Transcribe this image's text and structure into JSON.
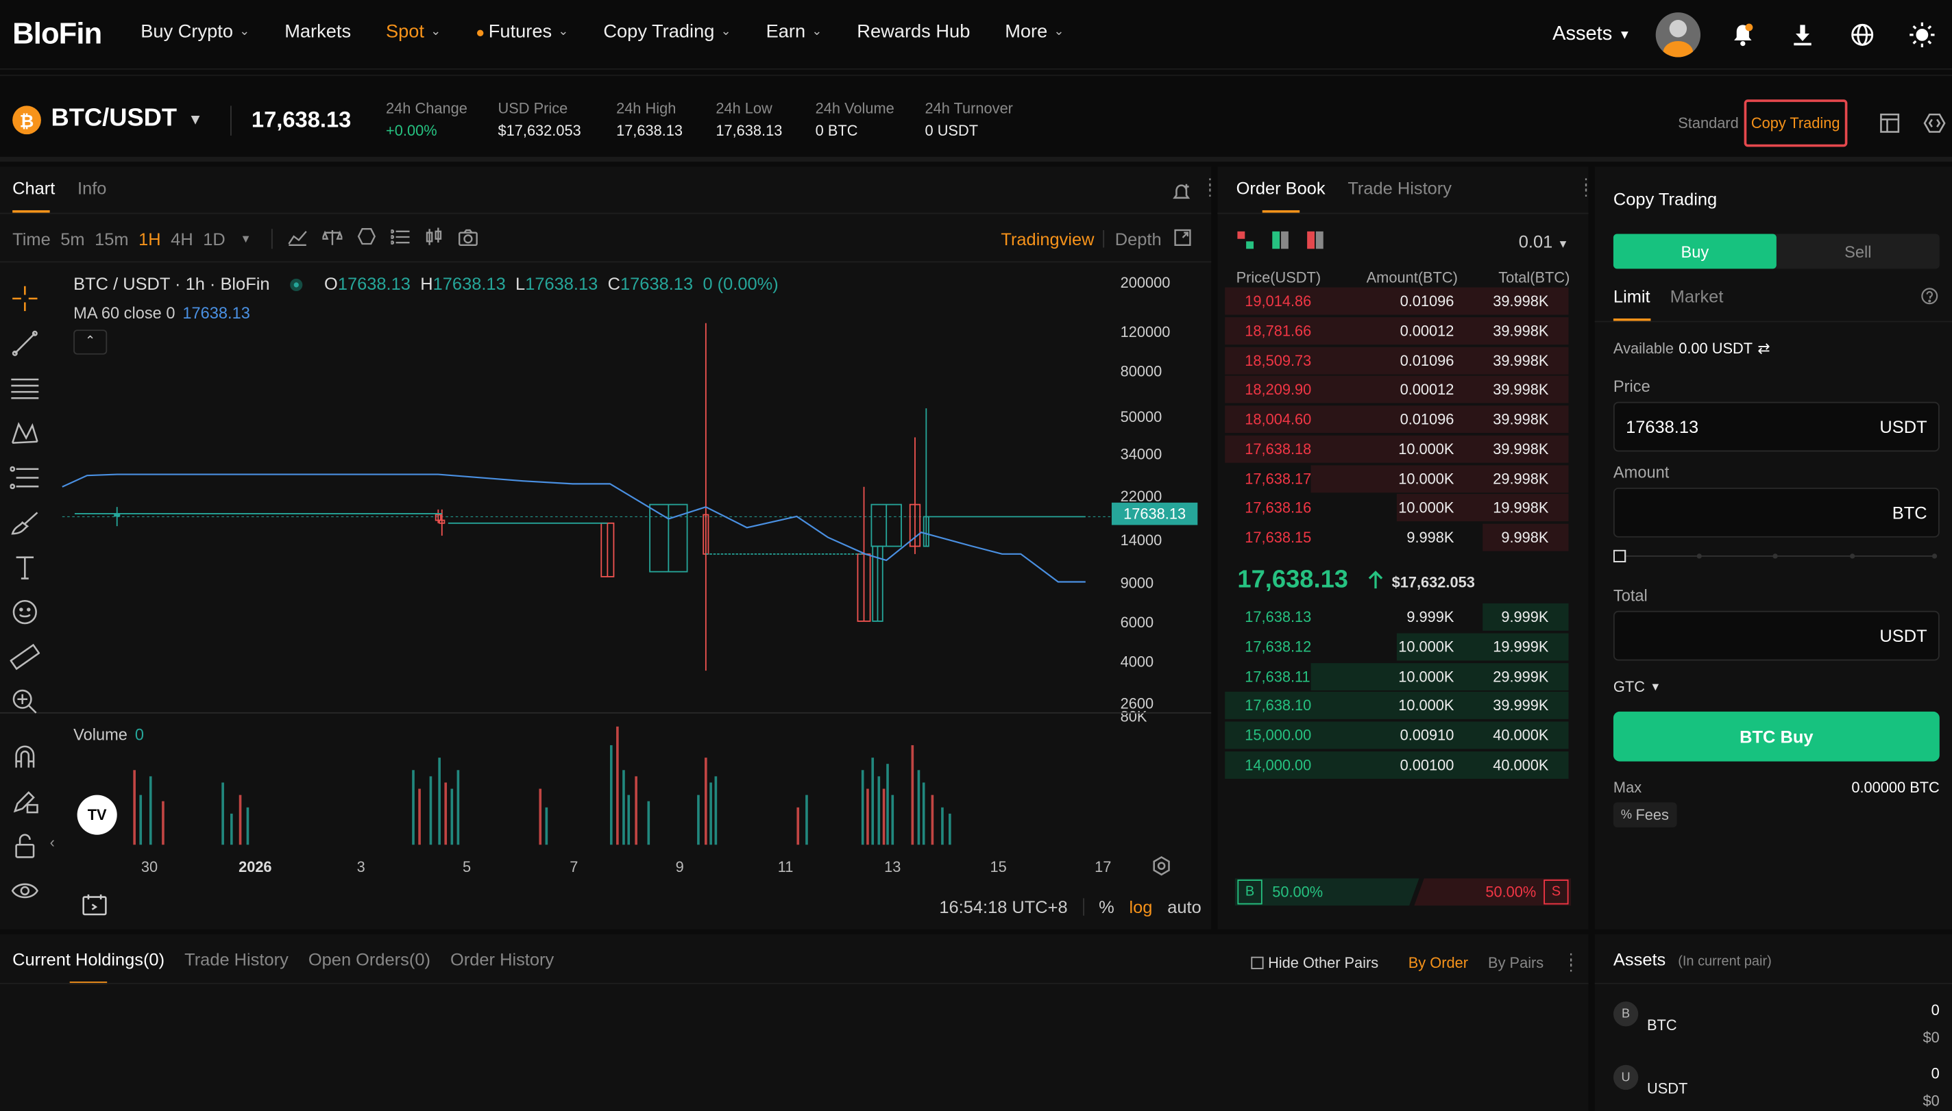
{
  "brand": "BloFin",
  "nav": {
    "items": [
      {
        "label": "Buy Crypto",
        "chev": true
      },
      {
        "label": "Markets",
        "chev": false
      },
      {
        "label": "Spot",
        "chev": true,
        "active": true
      },
      {
        "label": "Futures",
        "chev": true,
        "fire": true
      },
      {
        "label": "Copy Trading",
        "chev": true
      },
      {
        "label": "Earn",
        "chev": true
      },
      {
        "label": "Rewards Hub",
        "chev": false
      },
      {
        "label": "More",
        "chev": true
      }
    ],
    "assets": "Assets"
  },
  "ticker": {
    "pair": "BTC/USDT",
    "last": "17,638.13",
    "stats": [
      {
        "label": "24h Change",
        "value": "+0.00%",
        "green": true
      },
      {
        "label": "USD Price",
        "value": "$17,632.053"
      },
      {
        "label": "24h High",
        "value": "17,638.13"
      },
      {
        "label": "24h Low",
        "value": "17,638.13"
      },
      {
        "label": "24h Volume",
        "value": "0 BTC"
      },
      {
        "label": "24h Turnover",
        "value": "0 USDT"
      }
    ],
    "mode_standard": "Standard",
    "mode_copy": "Copy Trading"
  },
  "chart": {
    "tabs": [
      "Chart",
      "Info"
    ],
    "timeframes": [
      "Time",
      "5m",
      "15m",
      "1H",
      "4H",
      "1D"
    ],
    "active_tf": "1H",
    "tradingview": "Tradingview",
    "depth": "Depth",
    "legend_title": "BTC / USDT · 1h · BloFin",
    "ohlc": {
      "o": "17638.13",
      "h": "17638.13",
      "l": "17638.13",
      "c": "17638.13",
      "chg": "0 (0.00%)"
    },
    "ma_label": "MA 60 close 0",
    "ma_value": "17638.13",
    "price_label": "17638.13",
    "volume_label": "Volume",
    "volume_value": "0",
    "time": "16:54:18 UTC+8",
    "pct": "%",
    "log": "log",
    "auto": "auto"
  },
  "chart_data": {
    "type": "candlestick",
    "y_scale": "log",
    "y_ticks": [
      "200000",
      "120000",
      "80000",
      "50000",
      "34000",
      "22000",
      "14000",
      "9000",
      "6000",
      "4000",
      "2600",
      "80K"
    ],
    "x_ticks": [
      "30",
      "2026",
      "3",
      "5",
      "7",
      "9",
      "11",
      "13",
      "15",
      "17"
    ],
    "last_price": 17638.13
  },
  "orderbook": {
    "tabs": [
      "Order Book",
      "Trade History"
    ],
    "precision": "0.01",
    "headers": [
      "Price(USDT)",
      "Amount(BTC)",
      "Total(BTC)"
    ],
    "asks": [
      {
        "p": "19,014.86",
        "a": "0.01096",
        "t": "39.998K",
        "d": 1.0
      },
      {
        "p": "18,781.66",
        "a": "0.00012",
        "t": "39.998K",
        "d": 1.0
      },
      {
        "p": "18,509.73",
        "a": "0.01096",
        "t": "39.998K",
        "d": 1.0
      },
      {
        "p": "18,209.90",
        "a": "0.00012",
        "t": "39.998K",
        "d": 1.0
      },
      {
        "p": "18,004.60",
        "a": "0.01096",
        "t": "39.998K",
        "d": 1.0
      },
      {
        "p": "17,638.18",
        "a": "10.000K",
        "t": "39.998K",
        "d": 1.0
      },
      {
        "p": "17,638.17",
        "a": "10.000K",
        "t": "29.998K",
        "d": 0.75
      },
      {
        "p": "17,638.16",
        "a": "10.000K",
        "t": "19.998K",
        "d": 0.5
      },
      {
        "p": "17,638.15",
        "a": "9.998K",
        "t": "9.998K",
        "d": 0.25
      }
    ],
    "mid": "17,638.13",
    "mid_usd": "$17,632.053",
    "bids": [
      {
        "p": "17,638.13",
        "a": "9.999K",
        "t": "9.999K",
        "d": 0.25
      },
      {
        "p": "17,638.12",
        "a": "10.000K",
        "t": "19.999K",
        "d": 0.5
      },
      {
        "p": "17,638.11",
        "a": "10.000K",
        "t": "29.999K",
        "d": 0.75
      },
      {
        "p": "17,638.10",
        "a": "10.000K",
        "t": "39.999K",
        "d": 1.0
      },
      {
        "p": "15,000.00",
        "a": "0.00910",
        "t": "40.000K",
        "d": 1.0
      },
      {
        "p": "14,000.00",
        "a": "0.00100",
        "t": "40.000K",
        "d": 1.0
      }
    ],
    "buy_pct": "50.00%",
    "sell_pct": "50.00%",
    "b": "B",
    "s": "S"
  },
  "trade": {
    "title": "Copy Trading",
    "buy": "Buy",
    "sell": "Sell",
    "order_types": [
      "Limit",
      "Market"
    ],
    "available_label": "Available",
    "available_value": "0.00 USDT",
    "price_label": "Price",
    "price_value": "17638.13",
    "price_unit": "USDT",
    "amount_label": "Amount",
    "amount_unit": "BTC",
    "total_label": "Total",
    "total_unit": "USDT",
    "tif": "GTC",
    "submit": "BTC Buy",
    "max_label": "Max",
    "max_value": "0.00000 BTC",
    "fees": "Fees"
  },
  "bottom": {
    "tabs": [
      "Current Holdings(0)",
      "Trade History",
      "Open Orders(0)",
      "Order History"
    ],
    "hide_other": "Hide Other Pairs",
    "by_order": "By Order",
    "by_pairs": "By Pairs"
  },
  "assets": {
    "title": "Assets",
    "subtitle": "(In current pair)",
    "items": [
      {
        "coin": "BTC",
        "amount": "0",
        "usd": "$0"
      },
      {
        "coin": "USDT",
        "amount": "0",
        "usd": "$0"
      }
    ]
  },
  "colors": {
    "accent": "#f7931a",
    "green": "#26c281",
    "red": "#f23645",
    "buy": "#17c27f"
  }
}
